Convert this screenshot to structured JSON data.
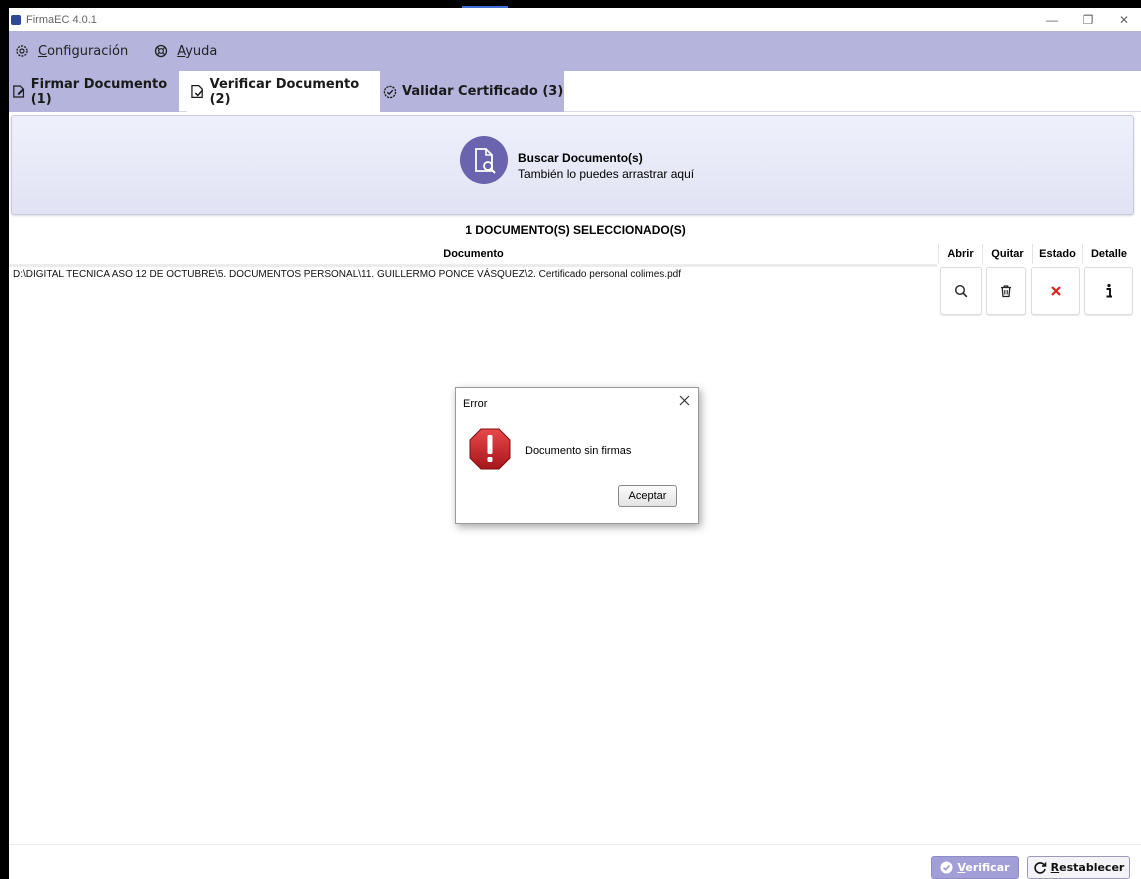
{
  "window": {
    "title": "FirmaEC 4.0.1",
    "minimize_glyph": "—",
    "restore_glyph": "❐",
    "close_glyph": "✕"
  },
  "menu": {
    "configuracion_prefix": "",
    "configuracion_accel": "C",
    "configuracion_rest": "onfiguración",
    "ayuda_accel": "A",
    "ayuda_rest": "yuda",
    "configuracion_icon": "gear-icon",
    "ayuda_icon": "help-lifebuoy-icon"
  },
  "tabs": [
    {
      "label": "Firmar Documento (1)",
      "icon": "sign-document-icon"
    },
    {
      "label": "Verificar Documento (2)",
      "icon": "verify-document-icon"
    },
    {
      "label": "Validar Certificado (3)",
      "icon": "check-circle-icon"
    }
  ],
  "dropzone": {
    "title": "Buscar Documento(s)",
    "subtitle": "También lo puedes arrastrar aquí",
    "icon": "document-search-icon"
  },
  "selection": {
    "count_label": "1 DOCUMENTO(S) SELECCIONADO(S)"
  },
  "table": {
    "headers": {
      "documento": "Documento",
      "abrir": "Abrir",
      "quitar": "Quitar",
      "estado": "Estado",
      "detalle": "Detalle"
    },
    "rows": [
      {
        "path": "D:\\DIGITAL TECNICA ASO 12 DE OCTUBRE\\5. DOCUMENTOS PERSONAL\\11. GUILLERMO PONCE VÁSQUEZ\\2. Certificado personal colimes.pdf",
        "abrir_icon": "magnifier-icon",
        "quitar_icon": "trash-icon",
        "estado_icon": "red-x-icon",
        "detalle_icon": "info-icon"
      }
    ]
  },
  "dialog": {
    "title": "Error",
    "message": "Documento sin firmas",
    "ok_label": "Aceptar",
    "icon": "error-octagon-icon"
  },
  "footer": {
    "verificar_accel": "V",
    "verificar_rest": "erificar",
    "restablecer_accel": "R",
    "restablecer_rest": "establecer"
  },
  "colors": {
    "menubar": "#b4b4dc",
    "accent": "#6a63ad",
    "error_red": "#c8262b",
    "estado_x": "#e02020"
  }
}
